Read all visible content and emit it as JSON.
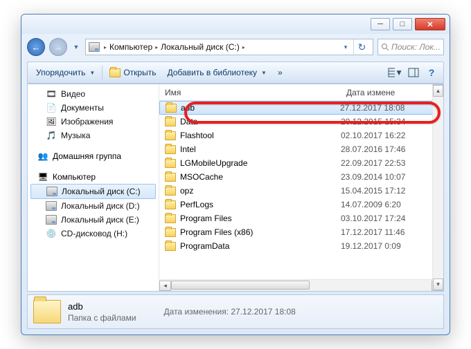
{
  "breadcrumb": {
    "root": "Компьютер",
    "drive": "Локальный диск (C:)"
  },
  "search": {
    "placeholder": "Поиск: Лок..."
  },
  "toolbar": {
    "organize": "Упорядочить",
    "open": "Открыть",
    "library": "Добавить в библиотеку",
    "more": "»"
  },
  "columns": {
    "name": "Имя",
    "date": "Дата измене"
  },
  "nav": {
    "libs": [
      {
        "label": "Видео",
        "icon": "video-icon"
      },
      {
        "label": "Документы",
        "icon": "document-icon"
      },
      {
        "label": "Изображения",
        "icon": "image-icon"
      },
      {
        "label": "Музыка",
        "icon": "music-icon"
      }
    ],
    "homegroup": "Домашняя группа",
    "computer": "Компьютер",
    "drives": [
      {
        "label": "Локальный диск (C:)",
        "selected": true
      },
      {
        "label": "Локальный диск (D:)"
      },
      {
        "label": "Локальный диск (E:)"
      },
      {
        "label": "CD-дисковод (H:)"
      }
    ]
  },
  "files": [
    {
      "name": "adb",
      "date": "27.12.2017 18:08",
      "selected": true
    },
    {
      "name": "Data",
      "date": "20.12.2015 15:34"
    },
    {
      "name": "Flashtool",
      "date": "02.10.2017 16:22"
    },
    {
      "name": "Intel",
      "date": "28.07.2016 17:46"
    },
    {
      "name": "LGMobileUpgrade",
      "date": "22.09.2017 22:53"
    },
    {
      "name": "MSOCache",
      "date": "23.09.2014 10:07"
    },
    {
      "name": "opz",
      "date": "15.04.2015 17:12"
    },
    {
      "name": "PerfLogs",
      "date": "14.07.2009 6:20"
    },
    {
      "name": "Program Files",
      "date": "03.10.2017 17:24"
    },
    {
      "name": "Program Files (x86)",
      "date": "17.12.2017 11:46"
    },
    {
      "name": "ProgramData",
      "date": "19.12.2017 0:09"
    }
  ],
  "details": {
    "name": "adb",
    "type": "Папка с файлами",
    "date_label": "Дата изменения:",
    "date": "27.12.2017 18:08"
  }
}
